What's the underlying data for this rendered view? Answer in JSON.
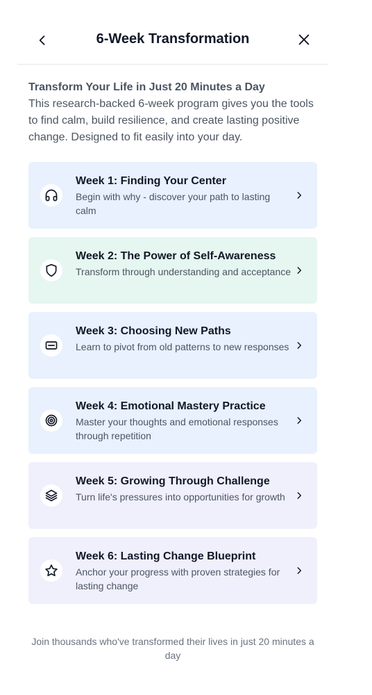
{
  "header": {
    "title": "6-Week Transformation",
    "back_icon": "chevron-left-icon",
    "close_icon": "close-icon"
  },
  "intro": {
    "heading": "Transform Your Life in Just 20 Minutes a Day",
    "body": "This research-backed 6-week program gives you the tools to find calm, build resilience, and create lasting positive change. Designed to fit easily into your day."
  },
  "weeks": [
    {
      "title": "Week 1: Finding Your Center",
      "description": "Begin with why - discover your path to lasting calm",
      "icon": "headphones-icon",
      "bg": "#e8f1fd"
    },
    {
      "title": "Week 2: The Power of Self-Awareness",
      "description": "Transform through understanding and acceptance",
      "icon": "shield-icon",
      "bg": "#e6f6f0"
    },
    {
      "title": "Week 3: Choosing New Paths",
      "description": "Learn to pivot from old patterns to new responses",
      "icon": "card-icon",
      "bg": "#e8f1fd"
    },
    {
      "title": "Week 4: Emotional Mastery Practice",
      "description": "Master your thoughts and emotional responses through repetition",
      "icon": "target-icon",
      "bg": "#e8f1fd"
    },
    {
      "title": "Week 5: Growing Through Challenge",
      "description": "Turn life's pressures into opportunities for growth",
      "icon": "layers-icon",
      "bg": "#f0effc"
    },
    {
      "title": "Week 6: Lasting Change Blueprint",
      "description": "Anchor your progress with proven strategies for lasting change",
      "icon": "star-icon",
      "bg": "#f0effc"
    }
  ],
  "footer": {
    "text": "Join thousands who've transformed their lives in just 20 minutes a day"
  }
}
